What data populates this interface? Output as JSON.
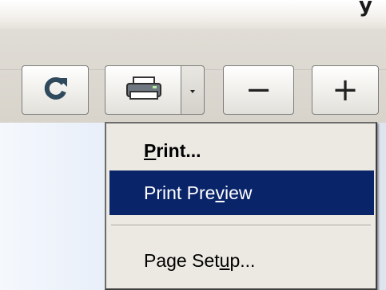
{
  "top": {
    "glyph": "y"
  },
  "toolbar": {
    "refresh_icon": "refresh-icon",
    "print_icon": "printer-icon",
    "dropdown_icon": "dropdown-arrow-icon",
    "zoom_out_label": "−",
    "zoom_in_label": "+"
  },
  "menu": {
    "items": [
      {
        "label": "Print...",
        "mnemonic_index": 0,
        "bold": true,
        "selected": false
      },
      {
        "label": "Print Preview",
        "mnemonic_index": 9,
        "bold": false,
        "selected": true
      },
      {
        "label": "Page Setup...",
        "mnemonic_index": 8,
        "bold": false,
        "selected": false
      }
    ]
  },
  "colors": {
    "selection": "#0a246a",
    "menu_bg": "#ece9e2",
    "toolbar_bg": "#d8d4cc"
  }
}
